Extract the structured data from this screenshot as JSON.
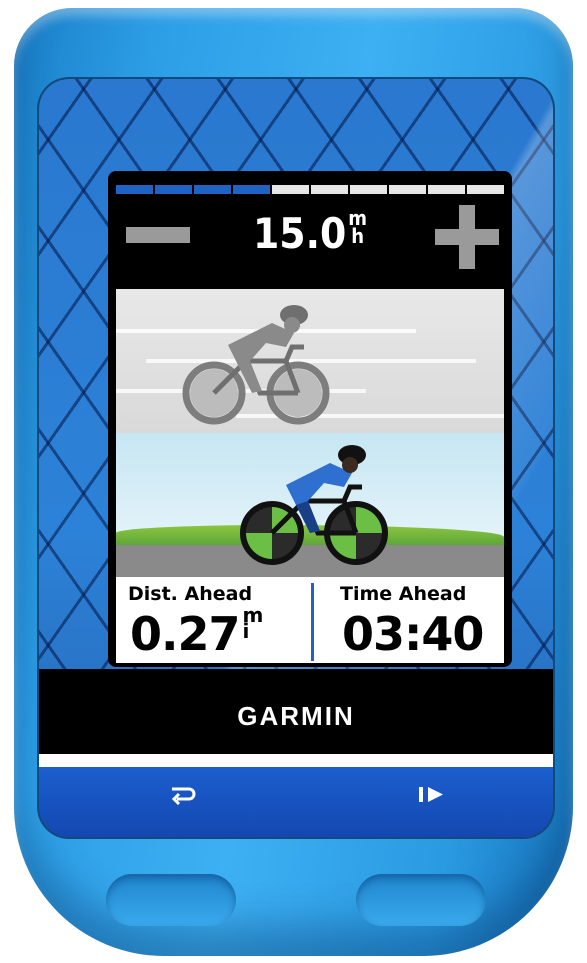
{
  "device": {
    "brand": "GARMIN",
    "colors": {
      "shell": "#2c9ee6",
      "accent": "#1f63c4"
    },
    "buttons": [
      {
        "name": "lap-button",
        "icon": "lap-arrow-icon",
        "glyph": "⟲"
      },
      {
        "name": "start-stop-button",
        "icon": "play-pause-icon",
        "glyph": "I▶"
      }
    ]
  },
  "screen": {
    "progress": {
      "segments_total": 10,
      "segments_done": 4
    },
    "speed": {
      "value": "15.0",
      "unit_top": "m",
      "unit_bottom": "h"
    },
    "speed_controls": {
      "decrease": "minus-icon",
      "increase": "plus-icon"
    },
    "scene": {
      "virtual_partner": "ghost-cyclist",
      "rider": "rider-cyclist"
    },
    "stats": {
      "left": {
        "label": "Dist. Ahead",
        "value": "0.27",
        "unit_top": "m",
        "unit_bottom": "i"
      },
      "right": {
        "label": "Time Ahead",
        "value": "03:40"
      }
    }
  }
}
